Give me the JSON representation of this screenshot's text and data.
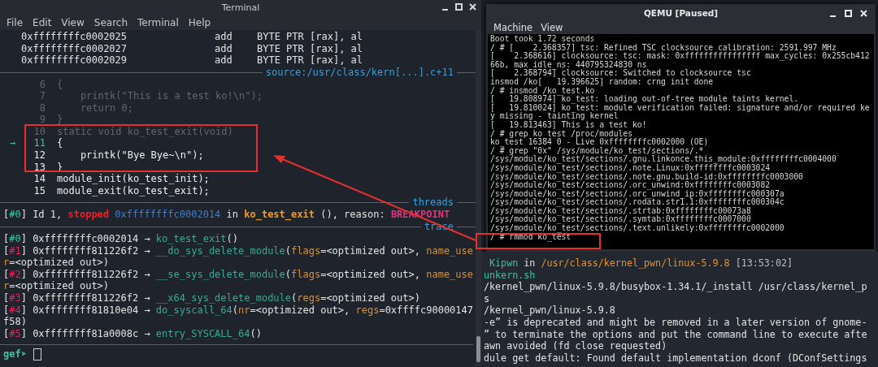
{
  "terminal": {
    "title": "Terminal",
    "menu": [
      "File",
      "Edit",
      "View",
      "Search",
      "Terminal",
      "Help"
    ],
    "disassembly": [
      {
        "address": "0xffffffffc0002025",
        "mnemonic": "add",
        "operands": "BYTE PTR [rax], al"
      },
      {
        "address": "0xffffffffc0002027",
        "mnemonic": "add",
        "operands": "BYTE PTR [rax], al"
      },
      {
        "address": "0xffffffffc0002029",
        "mnemonic": "add",
        "operands": "BYTE PTR [rax], al"
      }
    ],
    "source_header": "source:/usr/class/kern[...].c+11",
    "source_lines": [
      {
        "number": "6",
        "code": "{",
        "kind": "past"
      },
      {
        "number": "7",
        "code": "    printk(\"This is a test ko!\\n\");",
        "kind": "past"
      },
      {
        "number": "8",
        "code": "    return 0;",
        "kind": "past"
      },
      {
        "number": "9",
        "code": "}",
        "kind": "past"
      },
      {
        "number": "10",
        "code": "static void ko_test_exit(void)",
        "kind": "past"
      },
      {
        "number": "11",
        "code": "{",
        "kind": "current",
        "marker": "→"
      },
      {
        "number": "12",
        "code": "    printk(\"Bye Bye~\\n\");",
        "kind": "future"
      },
      {
        "number": "13",
        "code": "}",
        "kind": "future"
      },
      {
        "number": "14",
        "code": "module_init(ko_test_init);",
        "kind": "future"
      },
      {
        "number": "15",
        "code": "module_exit(ko_test_exit);",
        "kind": "future"
      }
    ],
    "threads_header": "threads",
    "thread_line": [
      {
        "text": "[",
        "kind": "plain"
      },
      {
        "text": "#0",
        "kind": "idx-current"
      },
      {
        "text": "] Id 1, ",
        "kind": "plain"
      },
      {
        "text": "stopped",
        "kind": "stopped"
      },
      {
        "text": " 0xffffffffc0002014",
        "kind": "addr"
      },
      {
        "text": " in ",
        "kind": "plain"
      },
      {
        "text": "ko_test_exit",
        "kind": "symbol"
      },
      {
        "text": " (), reason: ",
        "kind": "plain"
      },
      {
        "text": "BREAKPOINT",
        "kind": "reason"
      }
    ],
    "trace_header": "trace",
    "trace_lines": [
      [
        {
          "text": "[",
          "kind": "plain"
        },
        {
          "text": "#0",
          "kind": "idx-current"
        },
        {
          "text": "] 0xffffffffc0002014 → ",
          "kind": "plain"
        },
        {
          "text": "ko_test_exit",
          "kind": "func"
        },
        {
          "text": "()",
          "kind": "plain"
        }
      ],
      [
        {
          "text": "[",
          "kind": "plain"
        },
        {
          "text": "#1",
          "kind": "idx"
        },
        {
          "text": "] 0xffffffff811226f2 → ",
          "kind": "plain"
        },
        {
          "text": "__do_sys_delete_module",
          "kind": "func"
        },
        {
          "text": "(",
          "kind": "plain"
        },
        {
          "text": "flags",
          "kind": "param"
        },
        {
          "text": "=<optimized out>, ",
          "kind": "plain"
        },
        {
          "text": "name_use",
          "kind": "param"
        }
      ],
      [
        {
          "text": "r",
          "kind": "param"
        },
        {
          "text": "=<optimized out>)",
          "kind": "plain"
        }
      ],
      [
        {
          "text": "[",
          "kind": "plain"
        },
        {
          "text": "#2",
          "kind": "idx"
        },
        {
          "text": "] 0xffffffff811226f2 → ",
          "kind": "plain"
        },
        {
          "text": "__se_sys_delete_module",
          "kind": "func"
        },
        {
          "text": "(",
          "kind": "plain"
        },
        {
          "text": "flags",
          "kind": "param"
        },
        {
          "text": "=<optimized out>, ",
          "kind": "plain"
        },
        {
          "text": "name_use",
          "kind": "param"
        }
      ],
      [
        {
          "text": "r",
          "kind": "param"
        },
        {
          "text": "=<optimized out>)",
          "kind": "plain"
        }
      ],
      [
        {
          "text": "[",
          "kind": "plain"
        },
        {
          "text": "#3",
          "kind": "idx"
        },
        {
          "text": "] 0xffffffff811226f2 → ",
          "kind": "plain"
        },
        {
          "text": "__x64_sys_delete_module",
          "kind": "func"
        },
        {
          "text": "(",
          "kind": "plain"
        },
        {
          "text": "regs",
          "kind": "param"
        },
        {
          "text": "=<optimized out>)",
          "kind": "plain"
        }
      ],
      [
        {
          "text": "[",
          "kind": "plain"
        },
        {
          "text": "#4",
          "kind": "idx"
        },
        {
          "text": "] 0xffffffff81810e04 → ",
          "kind": "plain"
        },
        {
          "text": "do_syscall_64",
          "kind": "func"
        },
        {
          "text": "(",
          "kind": "plain"
        },
        {
          "text": "nr",
          "kind": "param"
        },
        {
          "text": "=<optimized out>, ",
          "kind": "plain"
        },
        {
          "text": "regs",
          "kind": "param"
        },
        {
          "text": "=0xffffc90000147",
          "kind": "plain"
        }
      ],
      [
        {
          "text": "f58)",
          "kind": "plain"
        }
      ],
      [
        {
          "text": "[",
          "kind": "plain"
        },
        {
          "text": "#5",
          "kind": "idx"
        },
        {
          "text": "] 0xffffffff81a0008c → ",
          "kind": "plain"
        },
        {
          "text": "entry_SYSCALL_64",
          "kind": "func"
        },
        {
          "text": "()",
          "kind": "plain"
        }
      ]
    ],
    "prompt": "gef➤"
  },
  "qemu": {
    "title": "QEMU [Paused]",
    "menu": [
      "Machine",
      "View"
    ],
    "console": [
      "Boot took 1.72 seconds",
      "/ # [    2.368357] tsc: Refined TSC clocksource calibration: 2591.997 MHz",
      "[    2.368616] clocksource: tsc: mask: 0xffffffffffffffff max_cycles: 0x255cb412",
      "66b, max_idle_ns: 440795324830 ns",
      "[    2.368794] clocksource: Switched to clocksource tsc",
      "insmod /ko[   19.396625] random: crng init done",
      "/ # insmod /ko_test.ko",
      "[   19.808974] ko_test: loading out-of-tree module taints kernel.",
      "[   19.810024] ko_test: module verification failed: signature and/or required ke",
      "y missing - tainting kernel",
      "[   19.813463] This is a test ko!",
      "/ # grep ko_test /proc/modules",
      "ko_test 16384 0 - Live 0xffffffffc0002000 (OE)",
      "/ # grep \"0x\" /sys/module/ko_test/sections/.*",
      "/sys/module/ko_test/sections/.gnu.linkonce.this_module:0xffffffffc0004000",
      "/sys/module/ko_test/sections/.note.Linux:0xffffffffc0003024",
      "/sys/module/ko_test/sections/.note.gnu.build-id:0xffffffffc0003000",
      "/sys/module/ko_test/sections/.orc_unwind:0xffffffffc0003082",
      "/sys/module/ko_test/sections/.orc_unwind_ip:0xffffffffc000307a",
      "/sys/module/ko_test/sections/.rodata.str1.1:0xffffffffc000304c",
      "/sys/module/ko_test/sections/.strtab:0xffffffffc00073a8",
      "/sys/module/ko_test/sections/.symtab:0xffffffffc0007000",
      "/sys/module/ko_test/sections/.text.unlikely:0xffffffffc0002000",
      "/ # rmmod ko_test"
    ]
  },
  "background_terminal": {
    "lines": [
      [
        {
          "text": " Kipwn",
          "kind": "user"
        },
        {
          "text": " in ",
          "kind": "plain"
        },
        {
          "text": "/usr/class/kernel_pwn/linux-5.9.8",
          "kind": "path"
        },
        {
          "text": " [13:53:02]",
          "kind": "time"
        }
      ],
      [
        {
          "text": "unkern.sh",
          "kind": "user"
        }
      ],
      [
        {
          "text": "/kernel_pwn/linux-5.9.8/busybox-1.34.1/_install /usr/class/kernel_p",
          "kind": "plain"
        }
      ],
      [
        {
          "text": "s",
          "kind": "plain"
        }
      ],
      [
        {
          "text": "/kernel_pwn/linux-5.9.8",
          "kind": "plain"
        }
      ],
      [
        {
          "text": "-e” is deprecated and might be removed in a later version of gnome-",
          "kind": "plain"
        }
      ],
      [
        {
          "text": "” to terminate the options and put the command line to execute afte",
          "kind": "plain"
        }
      ],
      [
        {
          "text": "awn avoided (fd close requested)",
          "kind": "plain"
        }
      ],
      [
        {
          "text": "dule get default: Found default implementation dconf (DConfSettings",
          "kind": "plain"
        }
      ]
    ]
  }
}
